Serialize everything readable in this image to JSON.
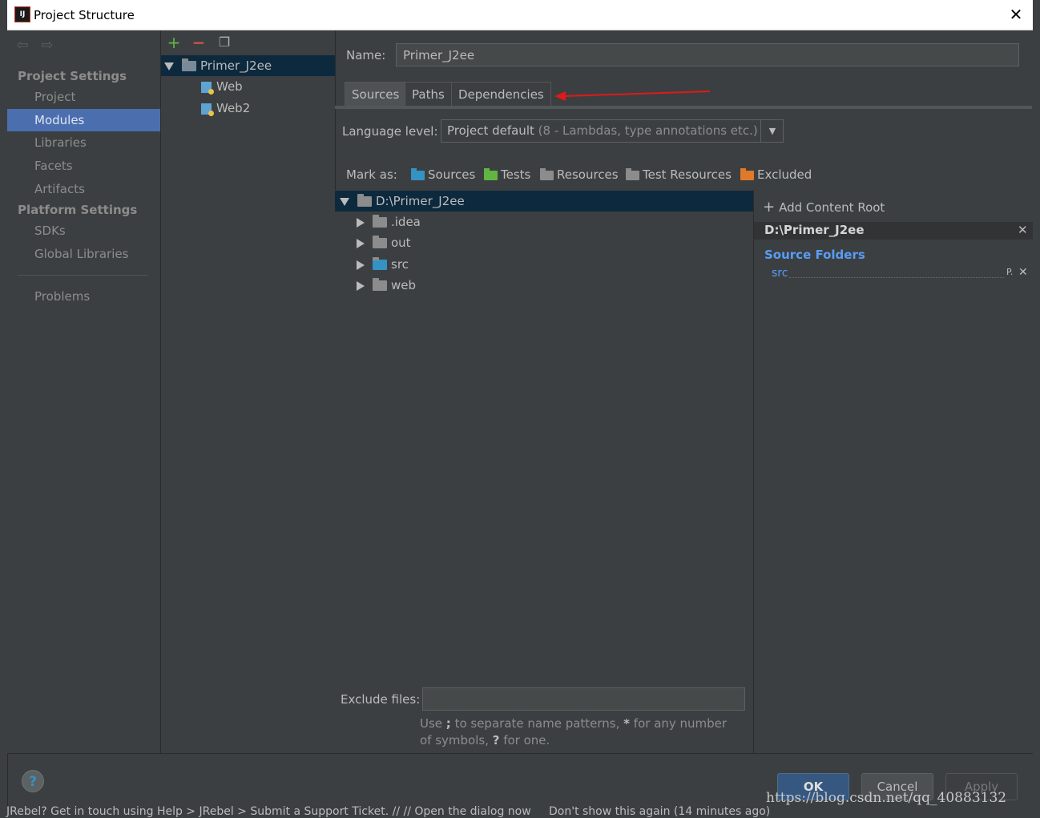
{
  "window": {
    "title": "Project Structure",
    "icon_text": "IJ"
  },
  "sidebar": {
    "project_settings_header": "Project Settings",
    "project_items": [
      "Project",
      "Modules",
      "Libraries",
      "Facets",
      "Artifacts"
    ],
    "platform_settings_header": "Platform Settings",
    "platform_items": [
      "SDKs",
      "Global Libraries"
    ],
    "problems_label": "Problems",
    "selected": "Modules"
  },
  "module_tree": {
    "root": "Primer_J2ee",
    "children": [
      "Web",
      "Web2"
    ]
  },
  "editor": {
    "name_label": "Name:",
    "name_value": "Primer_J2ee",
    "tabs": [
      "Sources",
      "Paths",
      "Dependencies"
    ],
    "active_tab": "Sources",
    "language_label": "Language level:",
    "language_value": "Project default",
    "language_detail": "(8 - Lambdas, type annotations etc.)",
    "mark_as_label": "Mark as:",
    "mark_as": [
      {
        "label": "Sources",
        "color": "#3592c4"
      },
      {
        "label": "Tests",
        "color": "#62b543"
      },
      {
        "label": "Resources",
        "color": "#8c8c8c"
      },
      {
        "label": "Test Resources",
        "color": "#8c8c8c"
      },
      {
        "label": "Excluded",
        "color": "#e07a2a"
      }
    ]
  },
  "content_tree": {
    "root": "D:\\Primer_J2ee",
    "folders": [
      ".idea",
      "out",
      "src",
      "web"
    ]
  },
  "exclude": {
    "label": "Exclude files:",
    "value": "",
    "help_pre": "Use ",
    "help_sep": ";",
    "help_mid": " to separate name patterns, ",
    "help_star": "*",
    "help_mid2": " for any number of symbols, ",
    "help_q": "?",
    "help_post": " for one."
  },
  "roots_panel": {
    "add_label": "Add Content Root",
    "root_path": "D:\\Primer_J2ee",
    "source_folders_title": "Source Folders",
    "source_folders": [
      "src"
    ]
  },
  "buttons": {
    "ok": "OK",
    "cancel": "Cancel",
    "apply": "Apply",
    "help": "?"
  },
  "background": {
    "status_text": "JRebel? Get in touch using Help > JRebel > Submit a Support Ticket. // // Open the dialog now",
    "status_text_dim": "Don't show this again (14 minutes ago)"
  },
  "watermark": "https://blog.csdn.net/qq_40883132",
  "colors": {
    "selection": "#4b6eaf",
    "tree_selection": "#0d293e",
    "link_blue": "#589df6",
    "arrow_red": "#e01919"
  }
}
